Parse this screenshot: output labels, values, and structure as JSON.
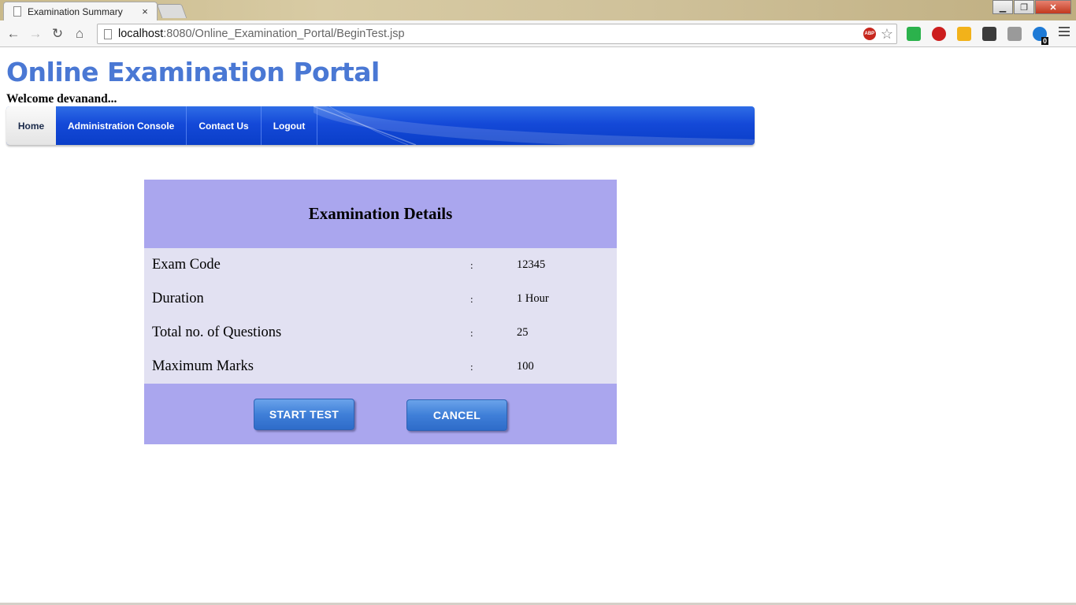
{
  "browser": {
    "tab_title": "Examination Summary",
    "tab_close": "×",
    "url_host": "localhost",
    "url_rest": ":8080/Online_Examination_Portal/BeginTest.jsp",
    "abp_label": "ABP",
    "window_controls": {
      "minimize": "▁",
      "restore": "❐",
      "close": "✕"
    },
    "nav_icons": {
      "back": "←",
      "forward": "→",
      "reload": "↻",
      "home": "⌂",
      "star": "☆"
    },
    "extensions": [
      {
        "name": "feedly-icon",
        "color": "#2bb24c"
      },
      {
        "name": "stop-icon",
        "color": "#cc1e1e"
      },
      {
        "name": "v-extension-icon",
        "color": "#f2b21a"
      },
      {
        "name": "evernote-icon",
        "color": "#3c3c3c"
      },
      {
        "name": "download-icon",
        "color": "#9a9a9a"
      },
      {
        "name": "badge-extension-icon",
        "color": "#1e7ad6"
      }
    ],
    "badge_count": "0"
  },
  "page": {
    "site_title": "Online Examination Portal",
    "welcome": "Welcome devanand...",
    "nav": {
      "home": "Home",
      "admin": "Administration Console",
      "contact": "Contact Us",
      "logout": "Logout"
    },
    "panel": {
      "heading": "Examination Details",
      "rows": [
        {
          "label": "Exam Code",
          "sep": ":",
          "value": "12345"
        },
        {
          "label": "Duration",
          "sep": ":",
          "value": "1 Hour"
        },
        {
          "label": "Total no. of Questions",
          "sep": ":",
          "value": "25"
        },
        {
          "label": "Maximum Marks",
          "sep": ":",
          "value": "100"
        }
      ],
      "start_label": "START TEST",
      "cancel_label": "CANCEL"
    }
  }
}
